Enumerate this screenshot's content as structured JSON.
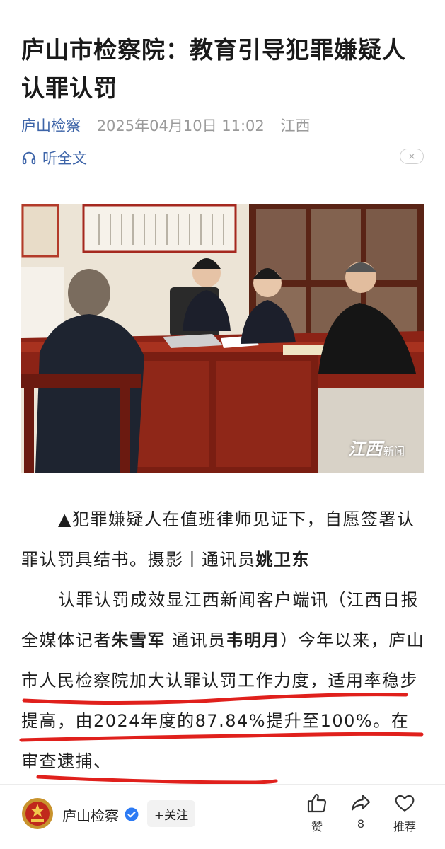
{
  "article": {
    "title": "庐山市检察院：教育引导犯罪嫌疑人认罪认罚",
    "source": "庐山检察",
    "date": "2025年04月10日 11:02",
    "region": "江西",
    "listen_label": "听全文",
    "close_symbol": "×"
  },
  "photo": {
    "watermark": "江西",
    "watermark_suffix": "新闻"
  },
  "body": {
    "p1_text": "▲犯罪嫌疑人在值班律师见证下，自愿签署认罪认罚具结书。摄影丨通讯员",
    "p1_bold": "姚卫东",
    "p2_text_a": "认罪认罚成效显江西新闻客户端讯（江西日报全媒体记者",
    "p2_bold_a": "朱雪军",
    "p2_text_b": " 通讯员",
    "p2_bold_b": "韦明月",
    "p2_text_c": "）今年以来，庐山市人民检察院加大认罪认罚工作力度，适用率稳步提高，由2024年度的87.84%提升至100%。在审查逮捕、"
  },
  "bottom_bar": {
    "account_name": "庐山检察",
    "follow_label": "+关注",
    "like_label": "赞",
    "share_count": "8",
    "recommend_label": "推荐"
  },
  "colors": {
    "link_blue": "#3d64a8",
    "annotation_red": "#e0201c",
    "verified_blue": "#2d7bf4"
  }
}
